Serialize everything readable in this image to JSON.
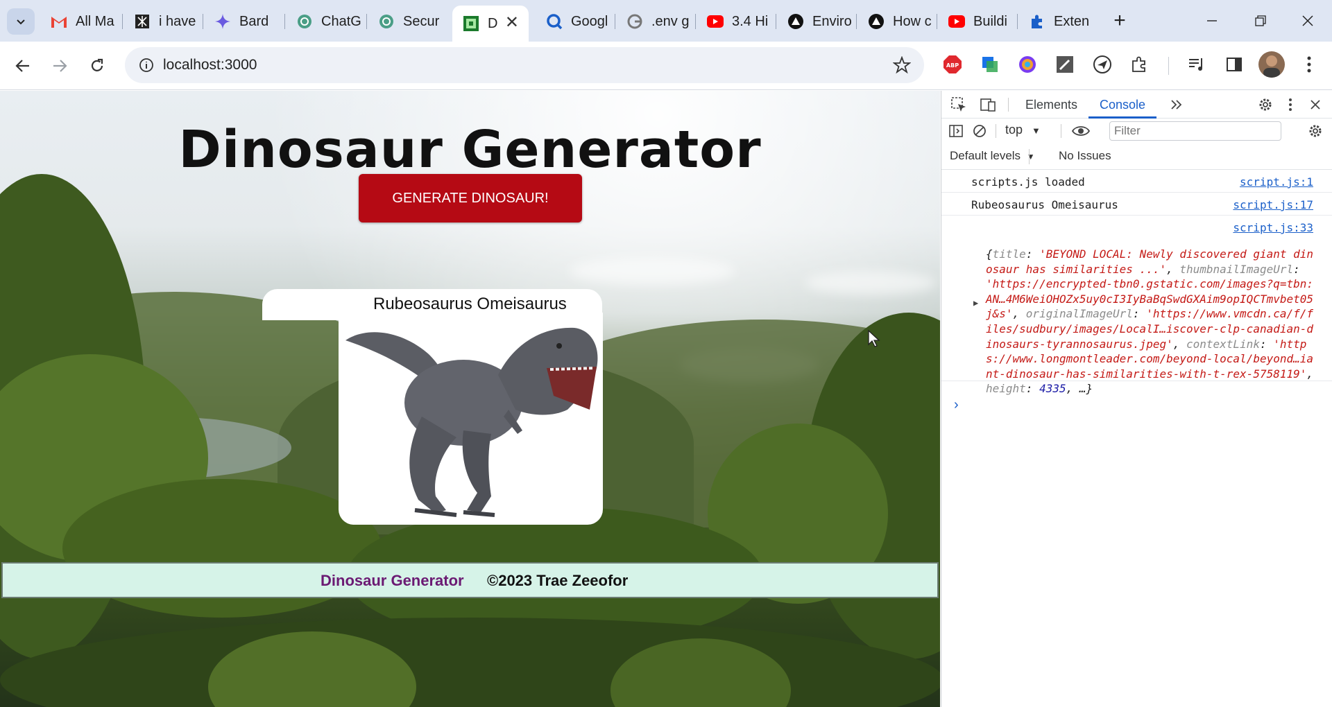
{
  "browser": {
    "tabs": [
      {
        "label": "All Ma",
        "icon": "gmail-icon",
        "color": "#ea4335"
      },
      {
        "label": "i have",
        "icon": "perplexity-icon",
        "color": "#222222"
      },
      {
        "label": "Bard",
        "icon": "bard-sparkle-icon",
        "color": "#6a5ae0"
      },
      {
        "label": "ChatG",
        "icon": "chatgpt-icon",
        "color": "#4a9e86"
      },
      {
        "label": "Secur",
        "icon": "chatgpt-icon",
        "color": "#4a9e86"
      },
      {
        "label": "D",
        "icon": "dino-favicon-icon",
        "color": "#1b7a2c",
        "active": true
      },
      {
        "label": "Googl",
        "icon": "google-lens-icon",
        "color": "#1a5fc9"
      },
      {
        "label": ".env g",
        "icon": "google-icon",
        "color": "#777777"
      },
      {
        "label": "3.4 Hi",
        "icon": "youtube-icon",
        "color": "#ff0000"
      },
      {
        "label": "Enviro",
        "icon": "vercel-icon",
        "color": "#111111"
      },
      {
        "label": "How c",
        "icon": "vercel-icon",
        "color": "#111111"
      },
      {
        "label": "Buildi",
        "icon": "youtube-icon",
        "color": "#ff0000"
      },
      {
        "label": "Exten",
        "icon": "puzzle-icon",
        "color": "#1a5fc9"
      }
    ],
    "url": "localhost:3000"
  },
  "page": {
    "title": "Dinosaur Generator",
    "button_label": "GENERATE DINOSAUR!",
    "dinosaur_name": "Rubeosaurus Omeisaurus",
    "footer_brand": "Dinosaur Generator",
    "footer_copyright": "©2023 Trae Zeeofor"
  },
  "devtools": {
    "tabs": [
      "Elements",
      "Console"
    ],
    "active_tab": "Console",
    "context": "top",
    "filter_placeholder": "Filter",
    "levels": "Default levels",
    "issues": "No Issues",
    "console": [
      {
        "message": "scripts.js loaded",
        "source": "script.js:1"
      },
      {
        "message": "Rubeosaurus Omeisaurus",
        "source": "script.js:17"
      },
      {
        "message": "",
        "source": "script.js:33"
      }
    ],
    "object": {
      "title_key": "title",
      "title_val": "'BEYOND LOCAL: Newly discovered giant dinosaur has similarities ...'",
      "thumb_key": "thumbnailImageUrl",
      "thumb_val": "'https://encrypted-tbn0.gstatic.com/images?q=tbn:AN…4M6WeiOHOZx5uy0cI3IyBaBqSwdGXAim9opIQCTmvbet05j&s'",
      "orig_key": "originalImageUrl",
      "orig_val": "'https://www.vmcdn.ca/f/files/sudbury/images/LocalI…iscover-clp-canadian-dinosaurs-tyrannosaurus.jpeg'",
      "ctx_key": "contextLink",
      "ctx_val": "'https://www.longmontleader.com/beyond-local/beyond…iant-dinosaur-has-similarities-with-t-rex-5758119'",
      "height_key": "height",
      "height_val": "4335",
      "ellipsis": "…}"
    }
  }
}
